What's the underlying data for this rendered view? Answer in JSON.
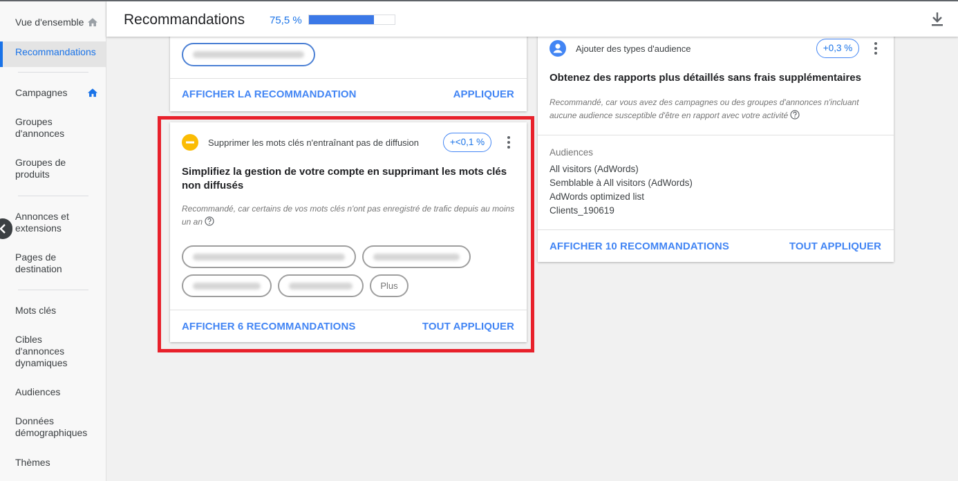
{
  "header": {
    "title": "Recommandations",
    "optimization_score": "75,5 %",
    "optimization_score_fraction": 0.755
  },
  "sidebar": {
    "items": [
      {
        "label": "Vue d'ensemble"
      },
      {
        "label": "Recommandations"
      },
      {
        "label": "Campagnes"
      },
      {
        "label": "Groupes d'annonces"
      },
      {
        "label": "Groupes de produits"
      },
      {
        "label": "Annonces et extensions"
      },
      {
        "label": "Pages de destination"
      },
      {
        "label": "Mots clés"
      },
      {
        "label": "Cibles d'annonces dynamiques"
      },
      {
        "label": "Audiences"
      },
      {
        "label": "Données démographiques"
      },
      {
        "label": "Thèmes"
      }
    ]
  },
  "card_top": {
    "view_label": "AFFICHER LA RECOMMANDATION",
    "apply_label": "APPLIQUER"
  },
  "card_keywords": {
    "head": "Supprimer les mots clés n'entraînant pas de diffusion",
    "impact": "+<0,1 %",
    "title": "Simplifiez la gestion de votre compte en supprimant les mots clés non diffusés",
    "reason": "Recommandé, car certains de vos mots clés n'ont pas enregistré de trafic depuis au moins un an",
    "more_chip": "Plus",
    "view_label": "AFFICHER 6 RECOMMANDATIONS",
    "apply_label": "TOUT APPLIQUER"
  },
  "card_audience": {
    "head": "Ajouter des types d'audience",
    "impact": "+0,3 %",
    "title": "Obtenez des rapports plus détaillés sans frais supplémentaires",
    "reason": "Recommandé, car vous avez des campagnes ou des groupes d'annonces n'incluant aucune audience susceptible d'être en rapport avec votre activité",
    "audiences_label": "Audiences",
    "audiences": [
      "All visitors (AdWords)",
      "Semblable à All visitors (AdWords)",
      "AdWords optimized list",
      "Clients_190619"
    ],
    "view_label": "AFFICHER 10 RECOMMANDATIONS",
    "apply_label": "TOUT APPLIQUER"
  },
  "colors": {
    "accent": "#1a73e8",
    "highlight": "#e8212b",
    "warning": "#fbbc04"
  }
}
